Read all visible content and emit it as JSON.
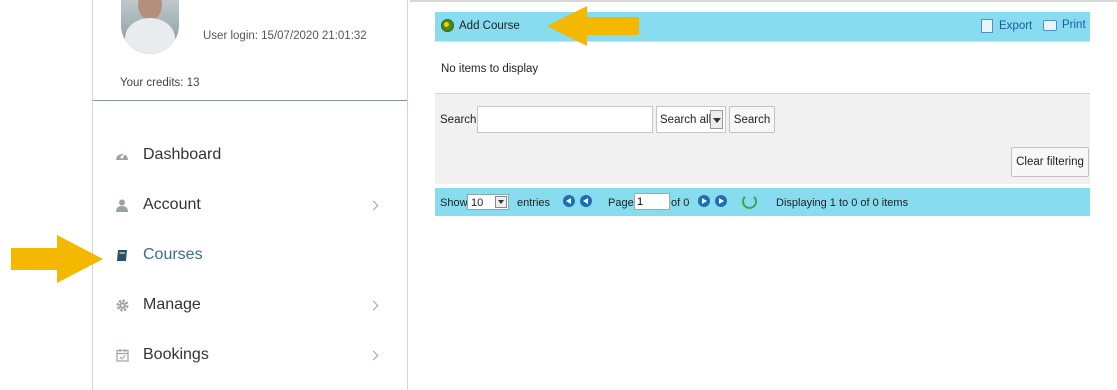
{
  "profile": {
    "login_text": "User login: 15/07/2020 21:01:32",
    "credits_text": "Your credits: 13"
  },
  "sidebar": {
    "items": [
      {
        "label": "Dashboard",
        "icon": "dashboard-icon",
        "has_chevron": false
      },
      {
        "label": "Account",
        "icon": "user-icon",
        "has_chevron": true
      },
      {
        "label": "Courses",
        "icon": "book-icon",
        "has_chevron": false,
        "active": true
      },
      {
        "label": "Manage",
        "icon": "gear-icon",
        "has_chevron": true
      },
      {
        "label": "Bookings",
        "icon": "calendar-icon",
        "has_chevron": true
      }
    ]
  },
  "toolbar": {
    "add_label": "Add Course",
    "export_label": "Export",
    "print_label": "Print"
  },
  "grid": {
    "empty_message": "No items to display"
  },
  "search": {
    "label": "Search:",
    "input_value": "",
    "scope_value": "Search all",
    "button_label": "Search",
    "clear_label": "Clear filtering"
  },
  "pager": {
    "show_label": "Show",
    "page_size": "10",
    "entries_label": "entries",
    "page_label": "Page",
    "page_value": "1",
    "of_label": "of 0",
    "display_text": "Displaying 1 to 0 of 0 items"
  },
  "colors": {
    "toolbar_bg": "#87dcf0",
    "active_item": "#3d6f86",
    "annotation_arrow": "#f5b800"
  }
}
